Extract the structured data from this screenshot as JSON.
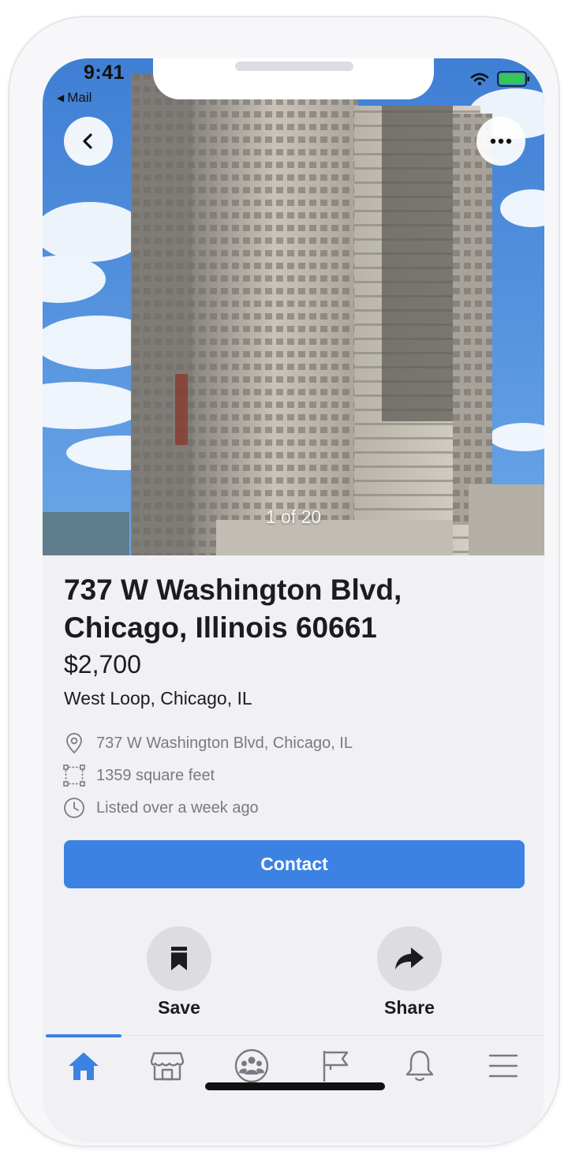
{
  "status": {
    "time": "9:41",
    "back_app": "Mail",
    "icons": [
      "wifi-icon",
      "battery-icon"
    ]
  },
  "nav": {
    "back_icon": "chevron-left-icon",
    "more_icon": "more-horizontal-icon"
  },
  "photo": {
    "counter": "1 of 20"
  },
  "listing": {
    "title": "737 W Washington Blvd, Chicago, Illinois 60661",
    "price": "$2,700",
    "neighborhood": "West Loop, Chicago, IL",
    "details": [
      {
        "icon": "location-pin-icon",
        "text": "737 W Washington Blvd, Chicago, IL"
      },
      {
        "icon": "area-icon",
        "text": "1359 square feet"
      },
      {
        "icon": "clock-icon",
        "text": "Listed over a week ago"
      }
    ]
  },
  "contact": {
    "label": "Contact"
  },
  "actions": {
    "save": {
      "label": "Save",
      "icon": "bookmark-icon"
    },
    "share": {
      "label": "Share",
      "icon": "share-arrow-icon"
    }
  },
  "tabbar": {
    "active": "home",
    "tabs": [
      "home",
      "marketplace",
      "groups",
      "pages",
      "notifications",
      "menu"
    ]
  },
  "colors": {
    "accent": "#3b82e3",
    "background": "#f0f0f5",
    "text": "#1c1c1e",
    "secondary_text": "#7a7a80"
  }
}
